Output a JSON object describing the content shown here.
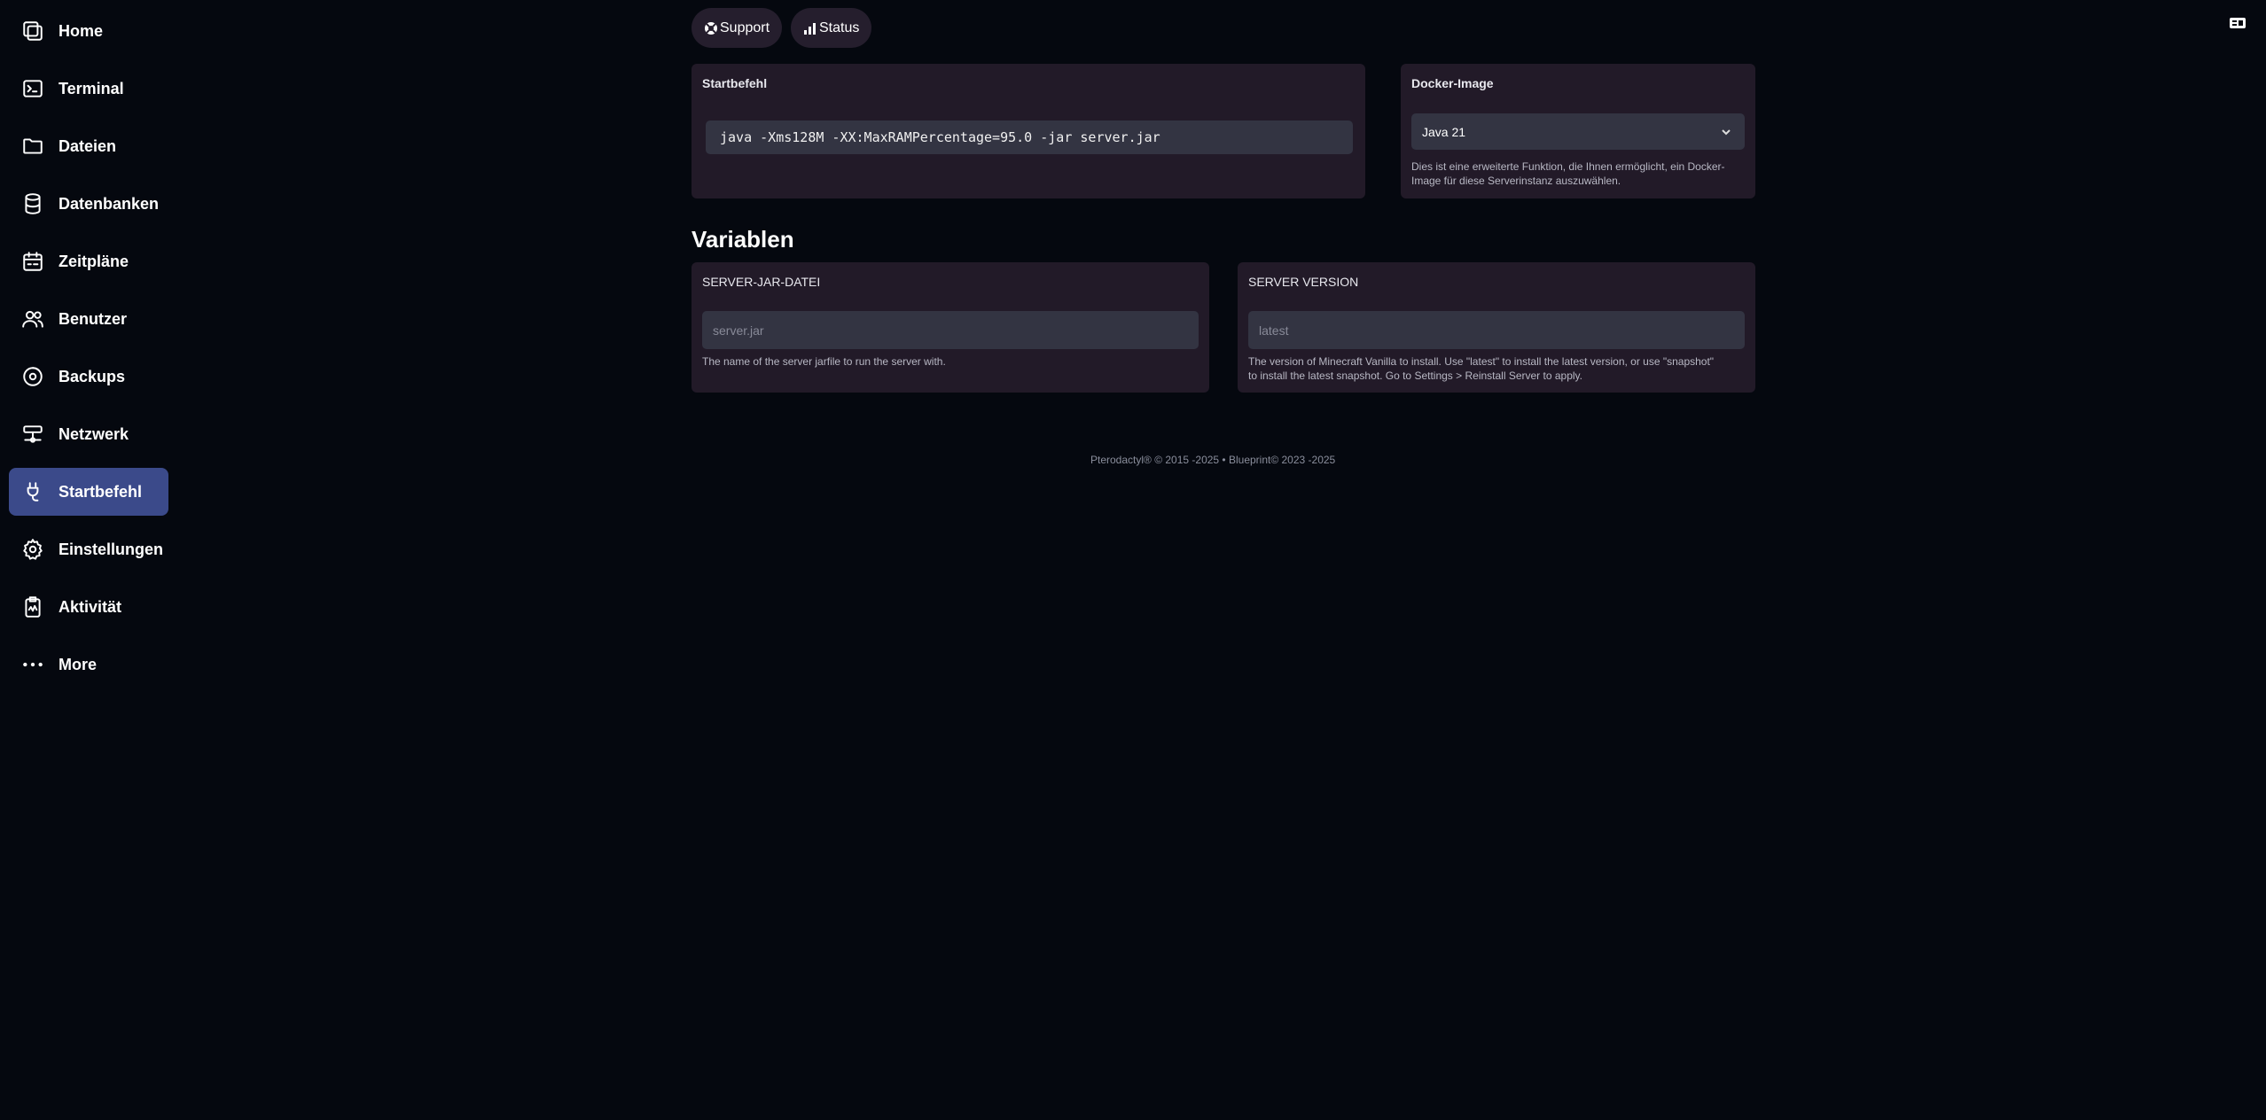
{
  "sidebar": {
    "items": [
      {
        "label": "Home",
        "icon": "home-icon"
      },
      {
        "label": "Terminal",
        "icon": "terminal-icon"
      },
      {
        "label": "Dateien",
        "icon": "folder-icon"
      },
      {
        "label": "Datenbanken",
        "icon": "database-icon"
      },
      {
        "label": "Zeitpläne",
        "icon": "calendar-icon"
      },
      {
        "label": "Benutzer",
        "icon": "users-icon"
      },
      {
        "label": "Backups",
        "icon": "backup-icon"
      },
      {
        "label": "Netzwerk",
        "icon": "network-icon"
      },
      {
        "label": "Startbefehl",
        "icon": "plug-icon",
        "active": true
      },
      {
        "label": "Einstellungen",
        "icon": "gear-icon"
      },
      {
        "label": "Aktivität",
        "icon": "activity-icon"
      },
      {
        "label": "More",
        "icon": "more-icon"
      }
    ]
  },
  "top_links": {
    "support": "Support",
    "status": "Status"
  },
  "startup": {
    "title": "Startbefehl",
    "command": "java -Xms128M -XX:MaxRAMPercentage=95.0 -jar server.jar"
  },
  "docker": {
    "title": "Docker-Image",
    "selected": "Java 21",
    "help_line1": "Dies ist eine erweiterte Funktion, die Ihnen ermöglicht, ein Docker-",
    "help_line2": "Image für diese Serverinstanz auszuwählen."
  },
  "variables": {
    "title": "Variablen",
    "jar": {
      "label": "SERVER-JAR-DATEI",
      "placeholder": "server.jar",
      "help": "The name of the server jarfile to run the server with."
    },
    "version": {
      "label": "SERVER VERSION",
      "placeholder": "latest",
      "help_line1": "The version of Minecraft Vanilla to install. Use \"latest\" to install the latest version, or use \"snapshot\"",
      "help_line2": "to install the latest snapshot. Go to Settings > Reinstall Server to apply."
    }
  },
  "footer": "Pterodactyl® © 2015 -2025  •  Blueprint© 2023 -2025",
  "colors": {
    "background": "#05080f",
    "card": "#221a28",
    "active_nav": "#3b4a8a",
    "input": "#333442"
  }
}
